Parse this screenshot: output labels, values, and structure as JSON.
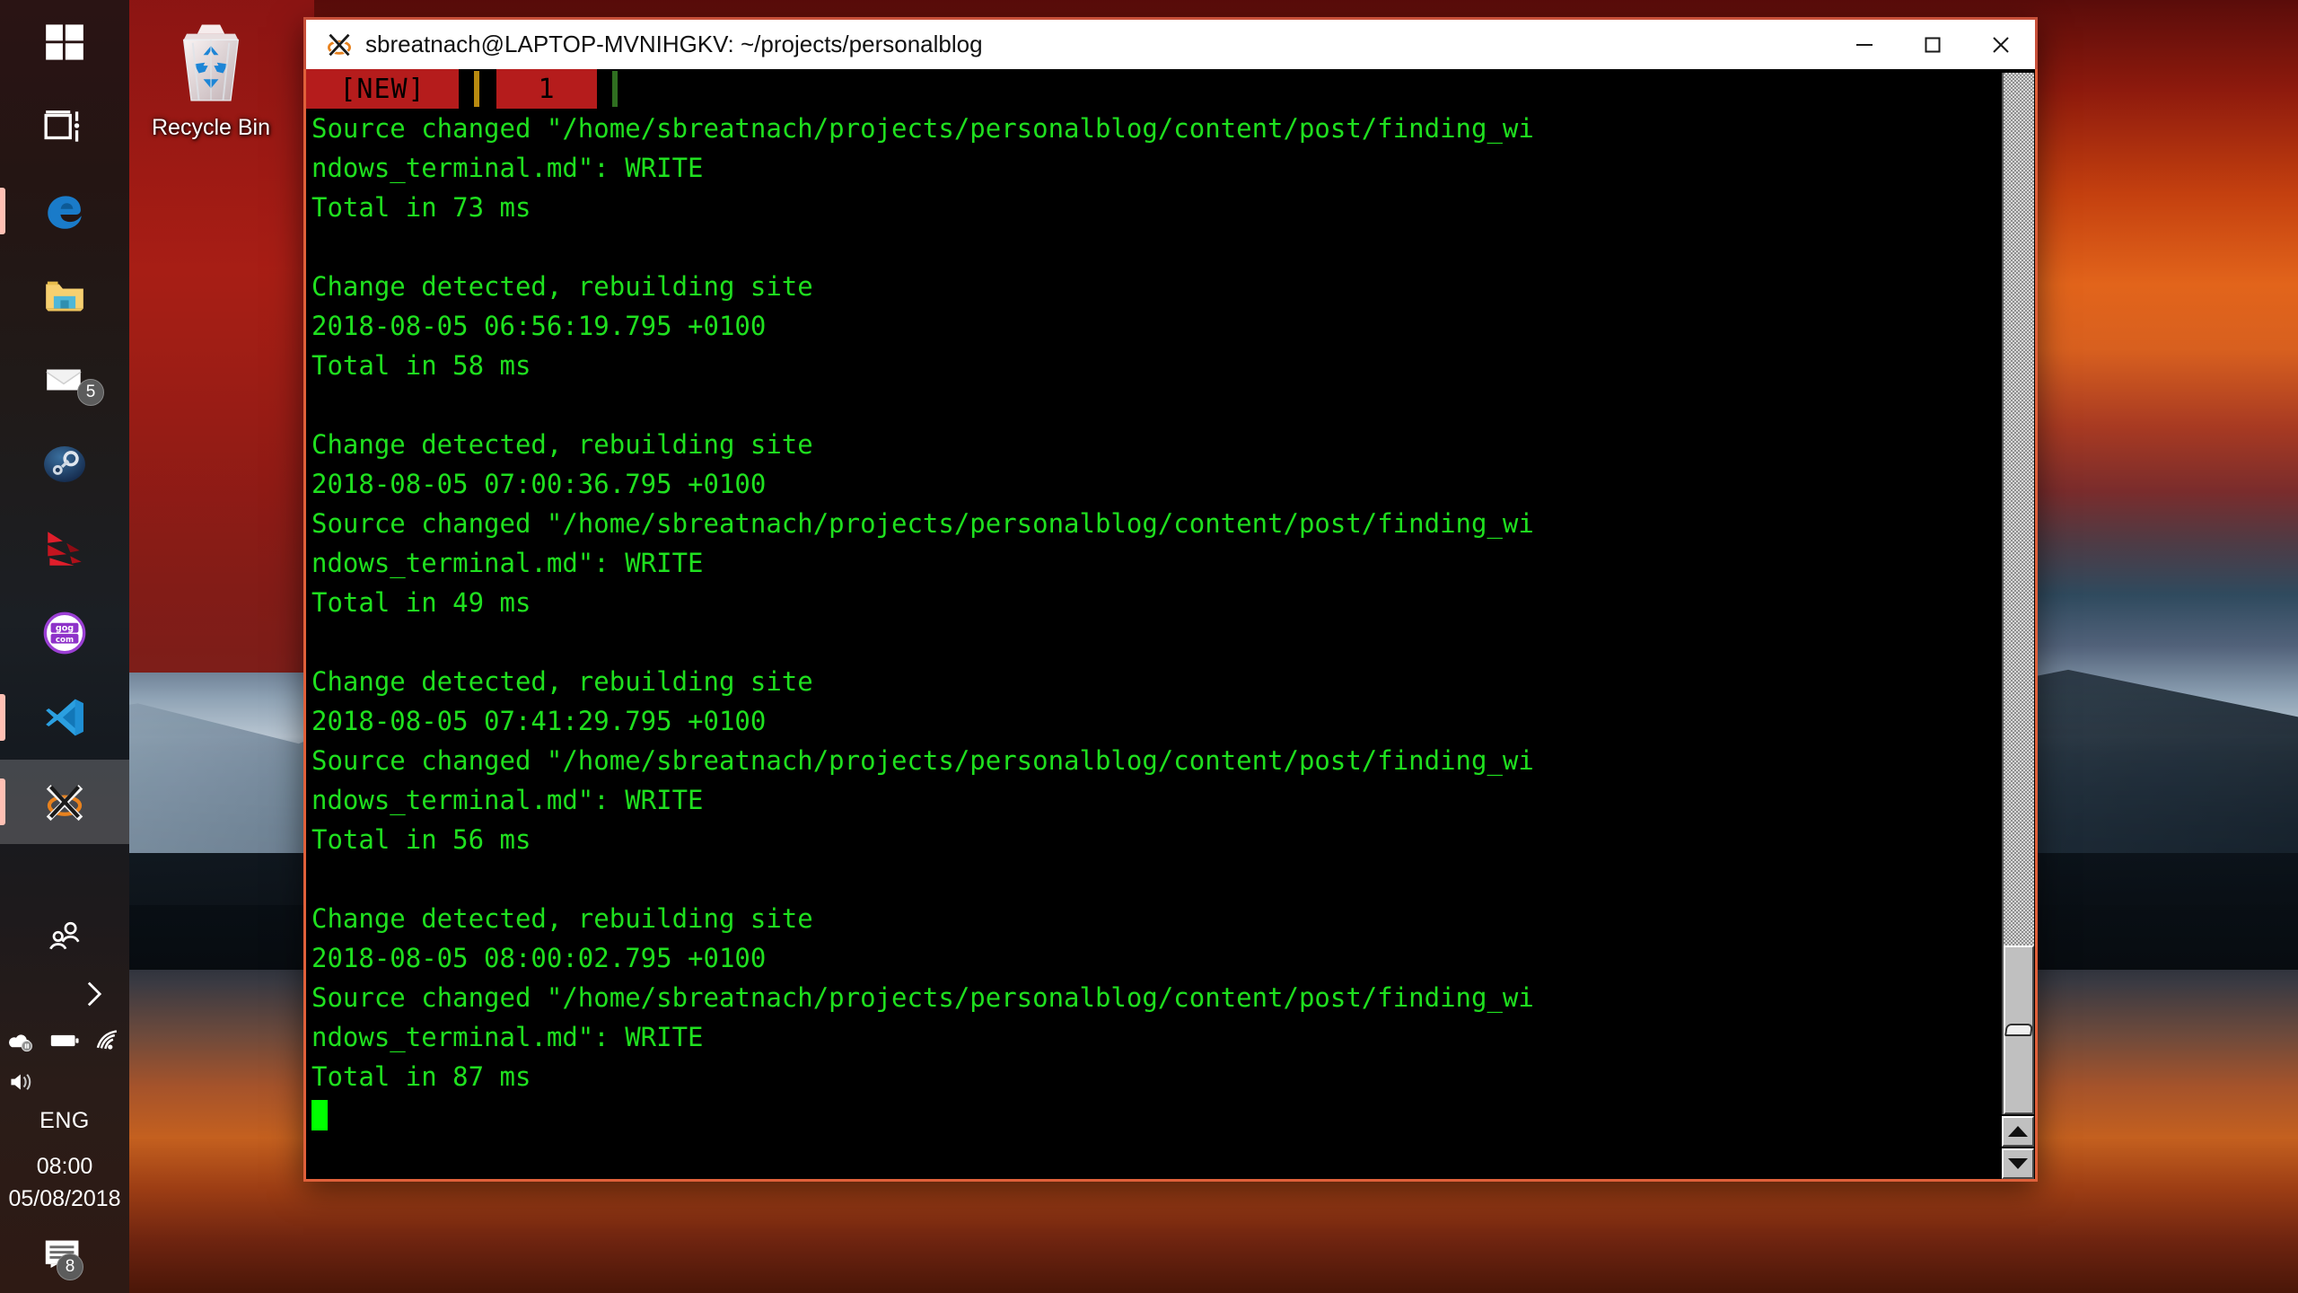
{
  "desktop": {
    "wallpaper_colors": {
      "sky": "#c4400f",
      "water": "#2b3c4c",
      "left_panel": "#a51b15"
    },
    "icons": [
      {
        "name": "recycle-bin",
        "label": "Recycle Bin"
      }
    ]
  },
  "taskbar": {
    "position": "left",
    "background": "#201a18",
    "items": [
      {
        "icon": "windows-start-icon",
        "label": "Start",
        "running": false,
        "active": false
      },
      {
        "icon": "task-view-icon",
        "label": "Task View",
        "running": false,
        "active": false
      },
      {
        "icon": "edge-icon",
        "label": "Microsoft Edge",
        "running": true,
        "active": false
      },
      {
        "icon": "file-explorer-icon",
        "label": "File Explorer",
        "running": false,
        "active": false
      },
      {
        "icon": "mail-icon",
        "label": "Mail",
        "running": false,
        "active": false,
        "badge": "5"
      },
      {
        "icon": "steam-icon",
        "label": "Steam",
        "running": false,
        "active": false
      },
      {
        "icon": "red-triangles-icon",
        "label": "Game Launcher",
        "running": false,
        "active": false
      },
      {
        "icon": "gog-com-icon",
        "label": "GOG Galaxy",
        "running": false,
        "active": false
      },
      {
        "icon": "vscode-icon",
        "label": "Visual Studio Code",
        "running": true,
        "active": false
      },
      {
        "icon": "x-server-icon",
        "label": "sbreatnach@LAPTOP-MVNIHGKV: ~/projects/personalblog",
        "running": true,
        "active": true
      }
    ],
    "tray": {
      "people_icon": "people-icon",
      "overflow_icon": "chevron-right-icon",
      "onedrive_icon": "onedrive-paused-icon",
      "battery_icon": "battery-icon",
      "wifi_icon": "wifi-icon",
      "volume_icon": "speaker-icon",
      "language": "ENG",
      "clock": {
        "time": "08:00",
        "date": "05/08/2018"
      },
      "notifications": {
        "icon": "notifications-icon",
        "badge": "8"
      }
    }
  },
  "window": {
    "title": "sbreatnach@LAPTOP-MVNIHGKV: ~/projects/personalblog",
    "title_icon": "x-server-icon",
    "border_color": "#e0603a",
    "controls": {
      "minimize": {
        "label": "—",
        "name": "minimize-button"
      },
      "maximize": {
        "label": "☐",
        "name": "maximize-button"
      },
      "close": {
        "label": "✕",
        "name": "close-button"
      }
    },
    "tabbar": {
      "background": "#000000",
      "tab_background": "#b51c1c",
      "tabs": [
        {
          "label": "[NEW]",
          "active": false
        },
        {
          "label": "1",
          "active": true
        }
      ],
      "separators": [
        {
          "color": "#b88a10"
        },
        {
          "color": "#2f6f20"
        }
      ]
    },
    "terminal": {
      "foreground": "#1fe01f",
      "background": "#000000",
      "cursor_color": "#00ff00",
      "lines": [
        "Source changed \"/home/sbreatnach/projects/personalblog/content/post/finding_wi",
        "ndows_terminal.md\": WRITE",
        "Total in 73 ms",
        "",
        "Change detected, rebuilding site",
        "2018-08-05 06:56:19.795 +0100",
        "Total in 58 ms",
        "",
        "Change detected, rebuilding site",
        "2018-08-05 07:00:36.795 +0100",
        "Source changed \"/home/sbreatnach/projects/personalblog/content/post/finding_wi",
        "ndows_terminal.md\": WRITE",
        "Total in 49 ms",
        "",
        "Change detected, rebuilding site",
        "2018-08-05 07:41:29.795 +0100",
        "Source changed \"/home/sbreatnach/projects/personalblog/content/post/finding_wi",
        "ndows_terminal.md\": WRITE",
        "Total in 56 ms",
        "",
        "Change detected, rebuilding site",
        "2018-08-05 08:00:02.795 +0100",
        "Source changed \"/home/sbreatnach/projects/personalblog/content/post/finding_wi",
        "ndows_terminal.md\": WRITE",
        "Total in 87 ms"
      ]
    },
    "scrollbar": {
      "orientation": "vertical",
      "thumb_position": "bottom",
      "up_arrow": "scroll-up-arrow-icon",
      "down_arrow": "scroll-down-arrow-icon"
    }
  }
}
